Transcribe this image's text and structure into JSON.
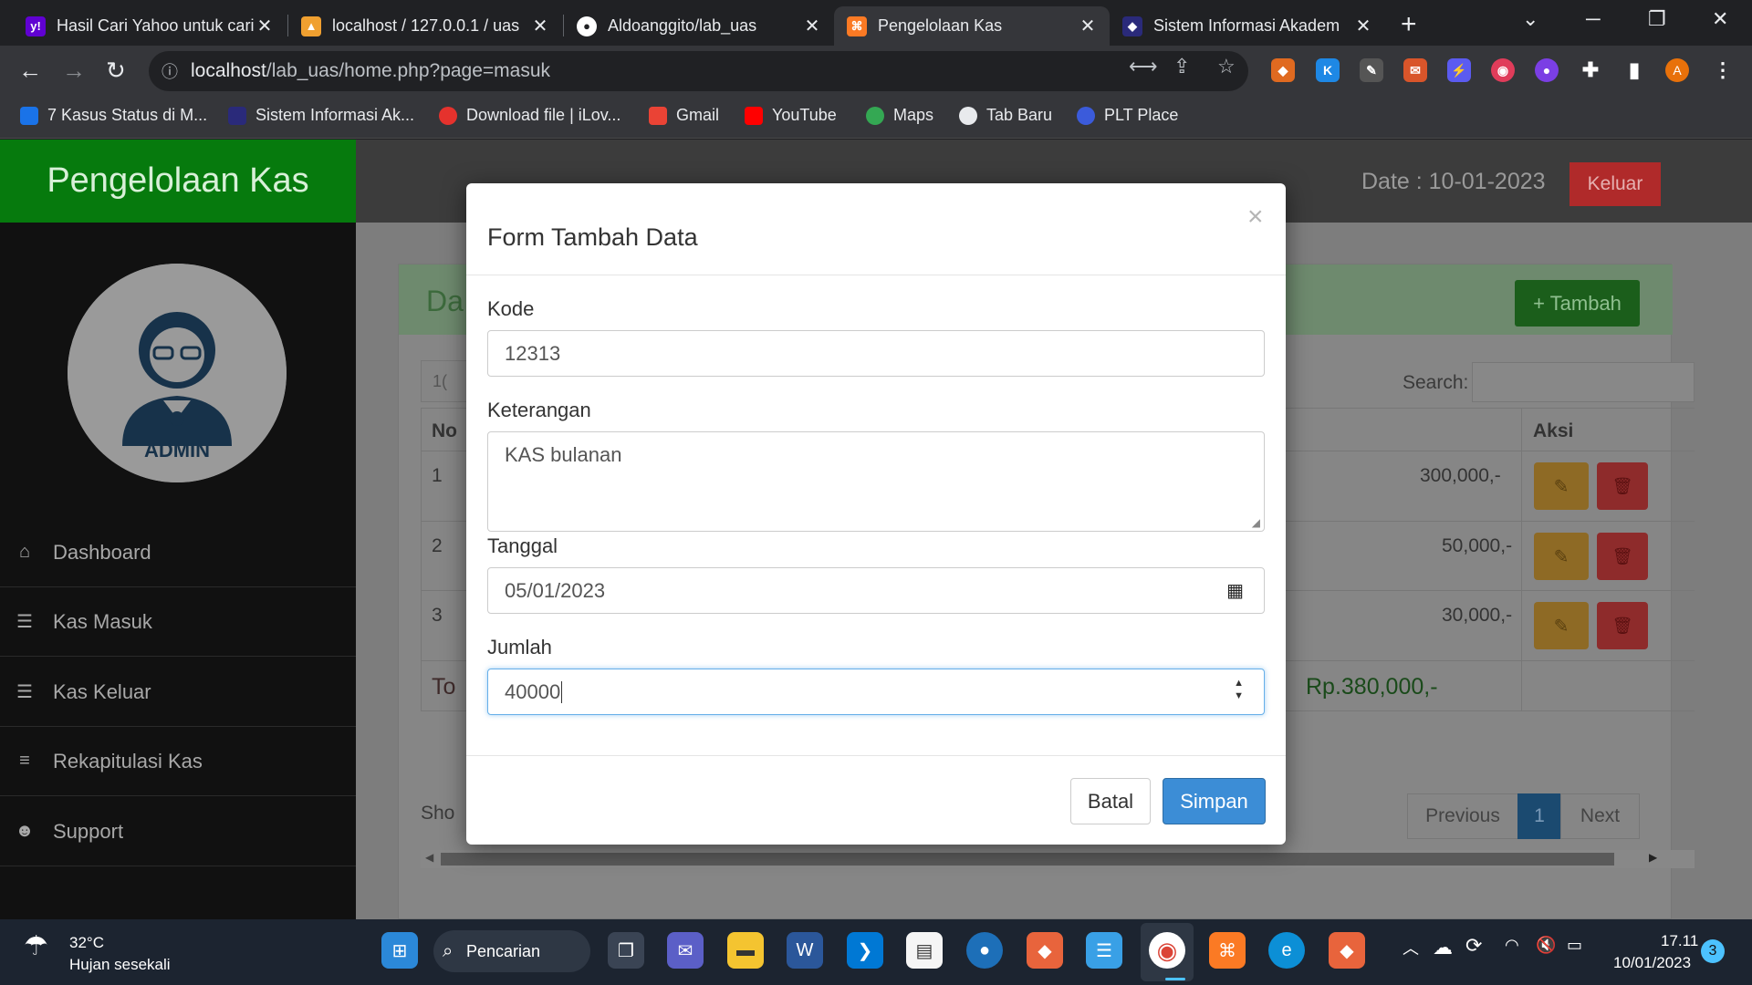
{
  "browser": {
    "tabs": [
      {
        "title": "Hasil Cari Yahoo untuk cari",
        "fav_color": "#6001d2",
        "fav_char": "y!"
      },
      {
        "title": "localhost / 127.0.0.1 / uas",
        "fav_color": "#f0a030",
        "fav_char": "▲"
      },
      {
        "title": "Aldoanggito/lab_uas",
        "fav_color": "#ffffff",
        "fav_char": "●"
      },
      {
        "title": "Pengelolaan Kas",
        "fav_color": "#fb7a24",
        "fav_char": "⌘"
      },
      {
        "title": "Sistem Informasi Akadem",
        "fav_color": "#2a2a7a",
        "fav_char": "◆"
      }
    ],
    "url_host": "localhost",
    "url_path": "/lab_uas/home.php?page=masuk",
    "bookmarks": [
      {
        "label": "7 Kasus Status di M...",
        "color": "#1a73e8"
      },
      {
        "label": "Sistem Informasi Ak...",
        "color": "#2a2a7a"
      },
      {
        "label": "Download file | iLov...",
        "color": "#e5322d"
      },
      {
        "label": "Gmail",
        "color": "#ea4335"
      },
      {
        "label": "YouTube",
        "color": "#ff0000"
      },
      {
        "label": "Maps",
        "color": "#34a853"
      },
      {
        "label": "Tab Baru",
        "color": "#e8eaed"
      },
      {
        "label": "PLT Place",
        "color": "#3b5bdb"
      }
    ],
    "profile_initial": "A"
  },
  "app": {
    "brand": "Pengelolaan Kas",
    "date_label": "Date : 10-01-2023",
    "logout": "Keluar",
    "avatar_label": "ADMIN",
    "menu": [
      {
        "label": "Dashboard",
        "icon": "⌂"
      },
      {
        "label": "Kas Masuk",
        "icon": "☰"
      },
      {
        "label": "Kas Keluar",
        "icon": "☰"
      },
      {
        "label": "Rekapitulasi Kas",
        "icon": "≡"
      },
      {
        "label": "Support",
        "icon": "☻"
      }
    ],
    "card_title_fragment": "Da",
    "add_button": "+ Tambah",
    "length_fragment": "1(",
    "search_label": "Search:",
    "table": {
      "col_no_fragment": "No",
      "col_aksi": "Aksi",
      "rows": [
        {
          "no": "1",
          "amount": "300,000,-"
        },
        {
          "no": "2",
          "amount": "50,000,-"
        },
        {
          "no": "3",
          "amount": "30,000,-"
        }
      ],
      "total_fragment": "To",
      "total": "Rp.380,000,-"
    },
    "showing_fragment": "Sho",
    "pager": {
      "previous": "Previous",
      "current": "1",
      "next": "Next"
    }
  },
  "modal": {
    "title": "Form Tambah Data",
    "close": "×",
    "fields": {
      "kode": {
        "label": "Kode",
        "value": "12313"
      },
      "keterangan": {
        "label": "Keterangan",
        "value": "KAS bulanan"
      },
      "tanggal": {
        "label": "Tanggal",
        "value": "05/01/2023"
      },
      "jumlah": {
        "label": "Jumlah",
        "value": "40000"
      }
    },
    "cancel": "Batal",
    "submit": "Simpan"
  },
  "taskbar": {
    "weather_temp": "32°C",
    "weather_desc": "Hujan sesekali",
    "search": "Pencarian",
    "time": "17.11",
    "date": "10/01/2023",
    "notif_count": "3"
  }
}
